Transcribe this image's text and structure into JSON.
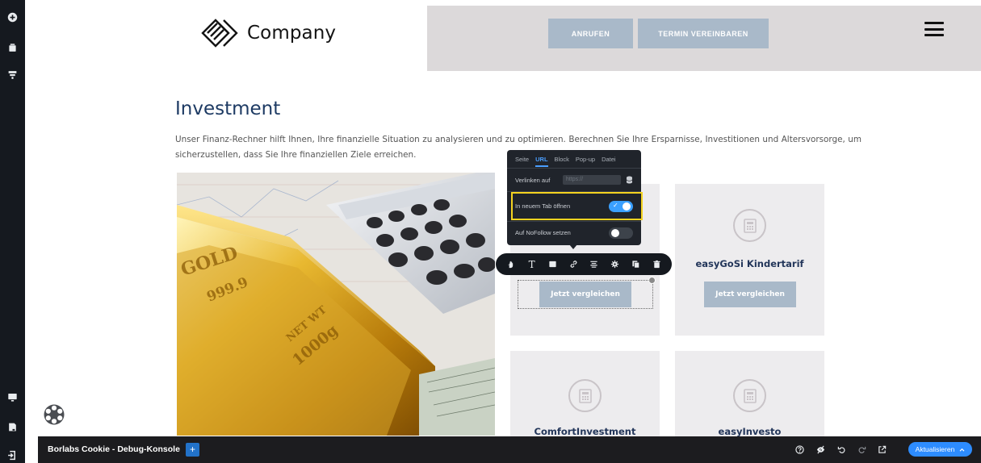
{
  "header": {
    "logo_text": "Company",
    "buttons": [
      "ANRUFEN",
      "TERMIN VEREINBAREN"
    ]
  },
  "content": {
    "title": "Investment",
    "intro": "Unser Finanz-Rechner hilft Ihnen, Ihre finanzielle Situation zu analysieren und zu optimieren. Berechnen Sie Ihre Ersparnisse, Investitionen und Altersvorsorge, um sicherzustellen, dass Sie Ihre finanziellen Ziele erreichen."
  },
  "cards": [
    {
      "title": "",
      "button": "Jetzt vergleichen"
    },
    {
      "title": "easyGoSi Kindertarif",
      "button": "Jetzt vergleichen"
    },
    {
      "title": "ComfortInvestment",
      "button": ""
    },
    {
      "title": "easyInvesto",
      "button": ""
    }
  ],
  "link_panel": {
    "tabs": [
      "Seite",
      "URL",
      "Block",
      "Pop-up",
      "Datei"
    ],
    "active_tab": "URL",
    "link_label": "Verlinken auf",
    "link_placeholder": "https://",
    "new_tab_label": "In neuem Tab öffnen",
    "new_tab_enabled": true,
    "nofollow_label": "Auf NoFollow setzen",
    "nofollow_enabled": false
  },
  "element_toolbar": {
    "icons": [
      "hand-icon",
      "text-icon",
      "background-icon",
      "link-icon",
      "align-icon",
      "settings-icon",
      "duplicate-icon",
      "delete-icon"
    ],
    "text_glyph": "T"
  },
  "left_toolbar": {
    "icons": [
      "add-icon",
      "blocks-icon",
      "layout-icon",
      "device-preview-icon",
      "pages-icon",
      "exit-icon"
    ]
  },
  "debug_bar": {
    "title": "Borlabs Cookie - Debug-Konsole",
    "plus": "+",
    "icons": [
      "help-icon",
      "no-preview-icon",
      "undo-icon",
      "redo-icon",
      "external-preview-icon"
    ],
    "update_label": "Aktualisieren"
  },
  "colors": {
    "accent": "#2d8cff",
    "heading": "#1d3a63",
    "button": "#a9b9c9",
    "card_bg": "#edecee",
    "highlight": "#f4d320"
  }
}
